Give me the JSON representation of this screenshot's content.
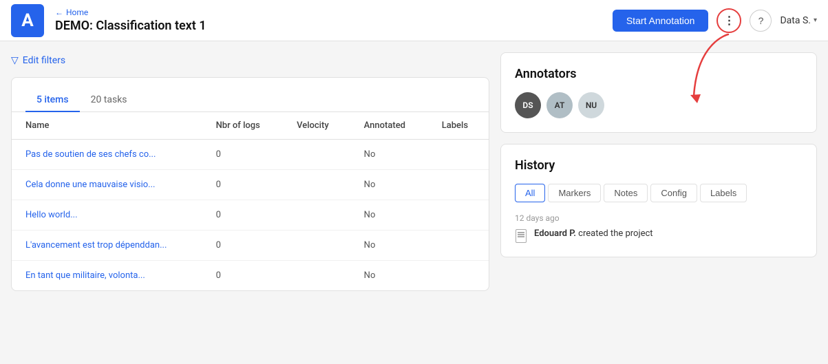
{
  "header": {
    "back_label": "Home",
    "title": "DEMO: Classification text 1",
    "start_annotation_label": "Start Annotation",
    "more_icon": "⋮",
    "help_icon": "?",
    "user_label": "Data S.",
    "logo_letter": "A"
  },
  "filter_bar": {
    "label": "Edit filters"
  },
  "tabs": [
    {
      "label": "5 items",
      "active": true
    },
    {
      "label": "20 tasks",
      "active": false
    }
  ],
  "table": {
    "columns": [
      "Name",
      "Nbr of logs",
      "Velocity",
      "Annotated",
      "Labels"
    ],
    "rows": [
      {
        "name": "Pas de soutien de ses chefs co...",
        "nbr_logs": "0",
        "velocity": "",
        "annotated": "No",
        "labels": ""
      },
      {
        "name": "Cela donne une mauvaise visio...",
        "nbr_logs": "0",
        "velocity": "",
        "annotated": "No",
        "labels": ""
      },
      {
        "name": "Hello world...",
        "nbr_logs": "0",
        "velocity": "",
        "annotated": "No",
        "labels": ""
      },
      {
        "name": "L'avancement est trop dépenddan...",
        "nbr_logs": "0",
        "velocity": "",
        "annotated": "No",
        "labels": ""
      },
      {
        "name": "En tant que militaire, volonta...",
        "nbr_logs": "0",
        "velocity": "",
        "annotated": "No",
        "labels": ""
      }
    ]
  },
  "annotators": {
    "title": "Annotators",
    "items": [
      {
        "initials": "DS",
        "class": "avatar-ds"
      },
      {
        "initials": "AT",
        "class": "avatar-at"
      },
      {
        "initials": "NU",
        "class": "avatar-nu"
      }
    ]
  },
  "history": {
    "title": "History",
    "tabs": [
      "All",
      "Markers",
      "Notes",
      "Config",
      "Labels"
    ],
    "active_tab": "All",
    "time_label": "12 days ago",
    "entry_text_bold": "Edouard P.",
    "entry_text_rest": " created the project"
  }
}
